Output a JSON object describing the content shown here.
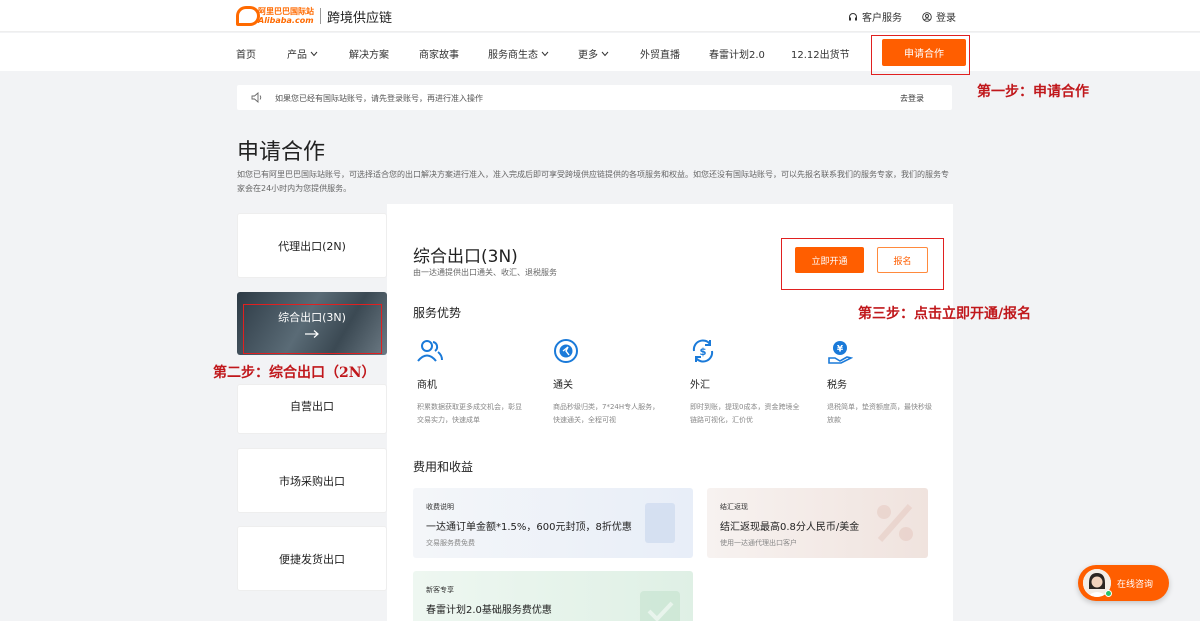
{
  "brand": {
    "logo_cn": "阿里巴巴国际站",
    "logo_en": "Alibaba.com",
    "name": "跨境供应链"
  },
  "top": {
    "service": "客户服务",
    "login": "登录"
  },
  "nav": {
    "items": [
      "首页",
      "产品",
      "解决方案",
      "商家故事",
      "服务商生态",
      "更多",
      "外贸直播",
      "春雷计划2.0",
      "12.12出货节"
    ],
    "apply": "申请合作"
  },
  "annotations": {
    "step1": "第一步：申请合作",
    "step2": "第二步：综合出口（2N）",
    "step3": "第三步：点击立即开通/报名"
  },
  "notice": {
    "text": "如果您已经有国际站账号，请先登录账号，再进行准入操作",
    "login": "去登录"
  },
  "page": {
    "title": "申请合作",
    "desc": "如您已有阿里巴巴国际站账号，可选择适合您的出口解决方案进行准入，准入完成后即可享受跨境供应链提供的各项服务和权益。如您还没有国际站账号，可以先报名联系我们的服务专家，我们的服务专家会在24小时内为您提供服务。"
  },
  "tabs": [
    "代理出口(2N)",
    "综合出口(3N)",
    "自营出口",
    "市场采购出口",
    "便捷发货出口"
  ],
  "panel": {
    "title": "综合出口(3N)",
    "subtitle": "由一达通提供出口通关、收汇、退税服务",
    "open_btn": "立即开通",
    "sign_btn": "报名",
    "adv_title": "服务优势",
    "advantages": [
      {
        "name": "商机",
        "desc": "积累数据获取更多成交机会，彰显交易实力，快速成单",
        "icon": "users-icon"
      },
      {
        "name": "通关",
        "desc": "商品秒级归类，7*24H专人服务，快速通关，全程可视",
        "icon": "customs-icon"
      },
      {
        "name": "外汇",
        "desc": "即时到账，提现0成本，资金跨境全链路可视化，汇价优",
        "icon": "exchange-icon"
      },
      {
        "name": "税务",
        "desc": "退税简单，垫资额度高，最快秒级放款",
        "icon": "tax-icon"
      }
    ],
    "fee_title": "费用和收益",
    "cards": [
      {
        "label": "收费说明",
        "main": "一达通订单金额*1.5%，600元封顶，8折优惠",
        "note": "交易服务费免费"
      },
      {
        "label": "结汇返现",
        "main": "结汇返现最高0.8分人民币/美金",
        "note": "使用一达通代理出口客户"
      },
      {
        "label": "新客专享",
        "main": "春雷计划2.0基础服务费优惠",
        "note": ""
      }
    ]
  },
  "chat": {
    "label": "在线咨询"
  }
}
